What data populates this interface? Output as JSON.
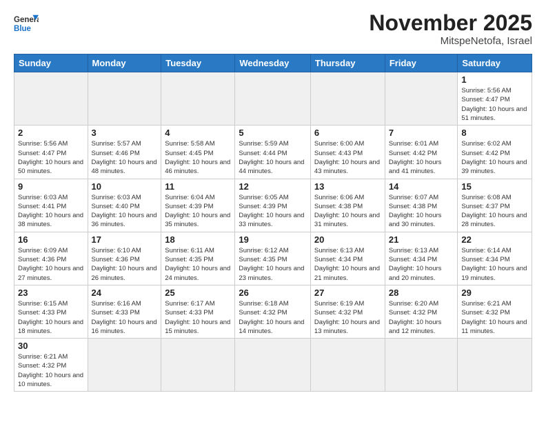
{
  "logo": {
    "general": "General",
    "blue": "Blue"
  },
  "title": "November 2025",
  "location": "MitspeNetofa, Israel",
  "weekdays": [
    "Sunday",
    "Monday",
    "Tuesday",
    "Wednesday",
    "Thursday",
    "Friday",
    "Saturday"
  ],
  "weeks": [
    [
      {
        "day": "",
        "empty": true
      },
      {
        "day": "",
        "empty": true
      },
      {
        "day": "",
        "empty": true
      },
      {
        "day": "",
        "empty": true
      },
      {
        "day": "",
        "empty": true
      },
      {
        "day": "",
        "empty": true
      },
      {
        "day": "1",
        "sunrise": "5:56 AM",
        "sunset": "4:47 PM",
        "daylight": "10 hours and 51 minutes."
      }
    ],
    [
      {
        "day": "2",
        "sunrise": "5:56 AM",
        "sunset": "4:47 PM",
        "daylight": "10 hours and 50 minutes."
      },
      {
        "day": "3",
        "sunrise": "5:57 AM",
        "sunset": "4:46 PM",
        "daylight": "10 hours and 48 minutes."
      },
      {
        "day": "4",
        "sunrise": "5:58 AM",
        "sunset": "4:45 PM",
        "daylight": "10 hours and 46 minutes."
      },
      {
        "day": "5",
        "sunrise": "5:59 AM",
        "sunset": "4:44 PM",
        "daylight": "10 hours and 44 minutes."
      },
      {
        "day": "6",
        "sunrise": "6:00 AM",
        "sunset": "4:43 PM",
        "daylight": "10 hours and 43 minutes."
      },
      {
        "day": "7",
        "sunrise": "6:01 AM",
        "sunset": "4:42 PM",
        "daylight": "10 hours and 41 minutes."
      },
      {
        "day": "8",
        "sunrise": "6:02 AM",
        "sunset": "4:42 PM",
        "daylight": "10 hours and 39 minutes."
      }
    ],
    [
      {
        "day": "9",
        "sunrise": "6:03 AM",
        "sunset": "4:41 PM",
        "daylight": "10 hours and 38 minutes."
      },
      {
        "day": "10",
        "sunrise": "6:03 AM",
        "sunset": "4:40 PM",
        "daylight": "10 hours and 36 minutes."
      },
      {
        "day": "11",
        "sunrise": "6:04 AM",
        "sunset": "4:39 PM",
        "daylight": "10 hours and 35 minutes."
      },
      {
        "day": "12",
        "sunrise": "6:05 AM",
        "sunset": "4:39 PM",
        "daylight": "10 hours and 33 minutes."
      },
      {
        "day": "13",
        "sunrise": "6:06 AM",
        "sunset": "4:38 PM",
        "daylight": "10 hours and 31 minutes."
      },
      {
        "day": "14",
        "sunrise": "6:07 AM",
        "sunset": "4:38 PM",
        "daylight": "10 hours and 30 minutes."
      },
      {
        "day": "15",
        "sunrise": "6:08 AM",
        "sunset": "4:37 PM",
        "daylight": "10 hours and 28 minutes."
      }
    ],
    [
      {
        "day": "16",
        "sunrise": "6:09 AM",
        "sunset": "4:36 PM",
        "daylight": "10 hours and 27 minutes."
      },
      {
        "day": "17",
        "sunrise": "6:10 AM",
        "sunset": "4:36 PM",
        "daylight": "10 hours and 26 minutes."
      },
      {
        "day": "18",
        "sunrise": "6:11 AM",
        "sunset": "4:35 PM",
        "daylight": "10 hours and 24 minutes."
      },
      {
        "day": "19",
        "sunrise": "6:12 AM",
        "sunset": "4:35 PM",
        "daylight": "10 hours and 23 minutes."
      },
      {
        "day": "20",
        "sunrise": "6:13 AM",
        "sunset": "4:34 PM",
        "daylight": "10 hours and 21 minutes."
      },
      {
        "day": "21",
        "sunrise": "6:13 AM",
        "sunset": "4:34 PM",
        "daylight": "10 hours and 20 minutes."
      },
      {
        "day": "22",
        "sunrise": "6:14 AM",
        "sunset": "4:34 PM",
        "daylight": "10 hours and 19 minutes."
      }
    ],
    [
      {
        "day": "23",
        "sunrise": "6:15 AM",
        "sunset": "4:33 PM",
        "daylight": "10 hours and 18 minutes."
      },
      {
        "day": "24",
        "sunrise": "6:16 AM",
        "sunset": "4:33 PM",
        "daylight": "10 hours and 16 minutes."
      },
      {
        "day": "25",
        "sunrise": "6:17 AM",
        "sunset": "4:33 PM",
        "daylight": "10 hours and 15 minutes."
      },
      {
        "day": "26",
        "sunrise": "6:18 AM",
        "sunset": "4:32 PM",
        "daylight": "10 hours and 14 minutes."
      },
      {
        "day": "27",
        "sunrise": "6:19 AM",
        "sunset": "4:32 PM",
        "daylight": "10 hours and 13 minutes."
      },
      {
        "day": "28",
        "sunrise": "6:20 AM",
        "sunset": "4:32 PM",
        "daylight": "10 hours and 12 minutes."
      },
      {
        "day": "29",
        "sunrise": "6:21 AM",
        "sunset": "4:32 PM",
        "daylight": "10 hours and 11 minutes."
      }
    ],
    [
      {
        "day": "30",
        "sunrise": "6:21 AM",
        "sunset": "4:32 PM",
        "daylight": "10 hours and 10 minutes."
      },
      {
        "day": "",
        "empty": true,
        "last": true
      },
      {
        "day": "",
        "empty": true,
        "last": true
      },
      {
        "day": "",
        "empty": true,
        "last": true
      },
      {
        "day": "",
        "empty": true,
        "last": true
      },
      {
        "day": "",
        "empty": true,
        "last": true
      },
      {
        "day": "",
        "empty": true,
        "last": true
      }
    ]
  ]
}
